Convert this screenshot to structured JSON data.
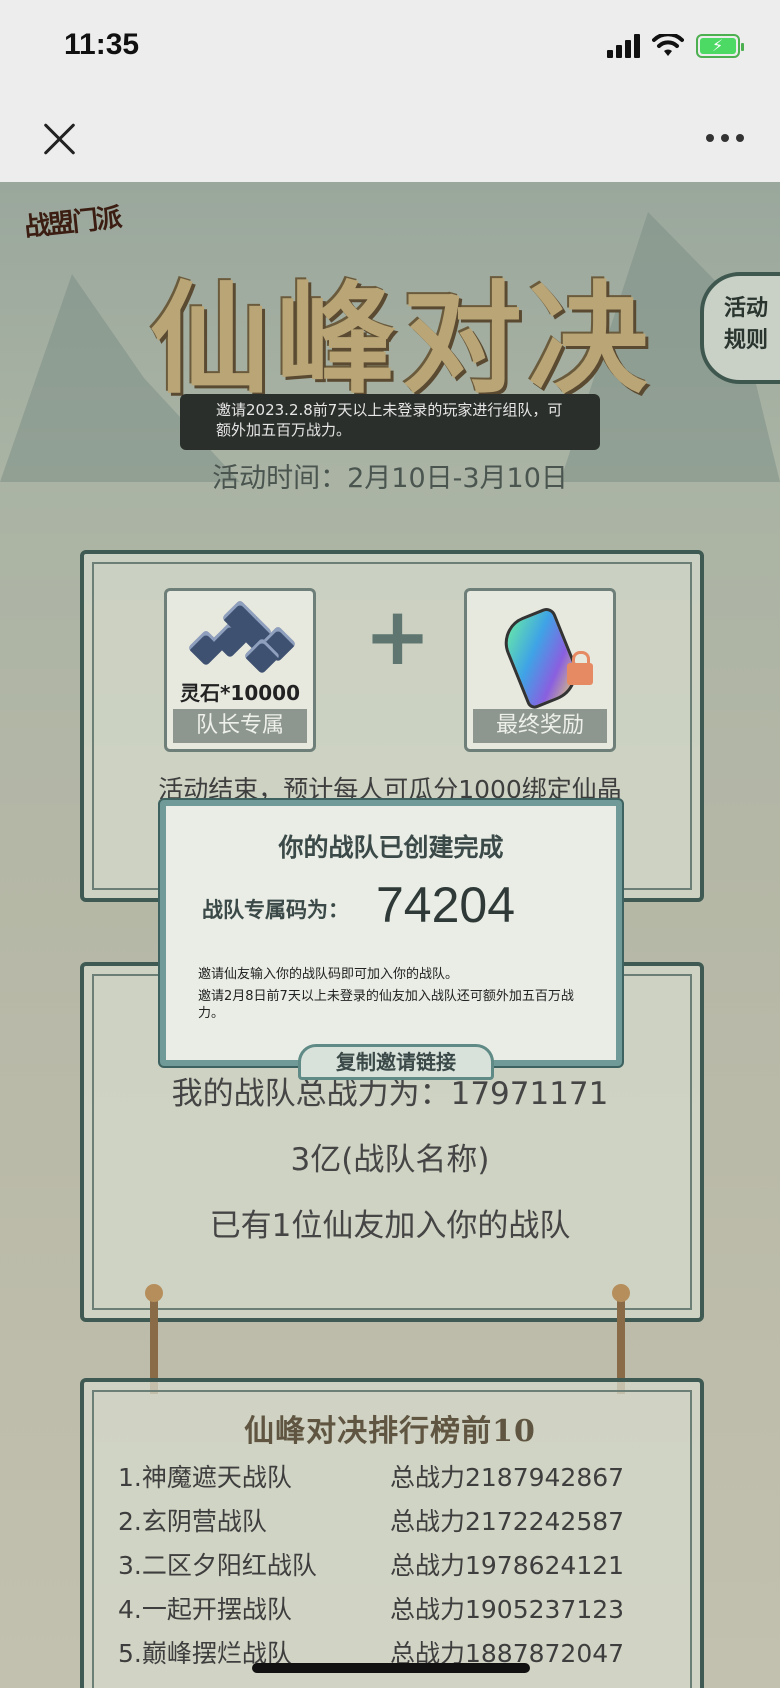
{
  "status_bar": {
    "time": "11:35"
  },
  "nav": {
    "close_icon": "close-icon",
    "more_icon": "more-icon"
  },
  "header": {
    "logo": "战盟门派",
    "title": "仙峰对决",
    "rules_button": "活动规则",
    "invite_banner": "邀请2023.2.8前7天以上未登录的玩家进行组队，可额外加五百万战力。",
    "activity_time": "活动时间：2月10日-3月10日"
  },
  "rewards": {
    "left_item_count": "灵石*10000",
    "left_label": "队长专属",
    "right_label": "最终奖励",
    "note": "活动结束，预计每人可瓜分1000绑定仙晶"
  },
  "team": {
    "total_power": "我的战队总战力为：17971171",
    "team_name": "3亿(战队名称)",
    "members": "已有1位仙友加入你的战队"
  },
  "leaderboard": {
    "title": "仙峰对决排行榜前10",
    "rows": [
      {
        "name": "1.神魔遮天战队",
        "power": "总战力2187942867"
      },
      {
        "name": "2.玄阴营战队",
        "power": "总战力2172242587"
      },
      {
        "name": "3.二区夕阳红战队",
        "power": "总战力1978624121"
      },
      {
        "name": "4.一起开摆战队",
        "power": "总战力1905237123"
      },
      {
        "name": "5.巅峰摆烂战队",
        "power": "总战力1887872047"
      }
    ]
  },
  "modal": {
    "title": "你的战队已创建完成",
    "code_label": "战队专属码为：",
    "code_value": "74204",
    "line1": "邀请仙友输入你的战队码即可加入你的战队。",
    "line2": "邀请2月8日前7天以上未登录的仙友加入战队还可额外加五百万战力。",
    "copy_button": "复制邀请链接"
  },
  "colors": {
    "accent": "#3e5a52",
    "modal_border": "#6f9a97",
    "battery": "#4cd964"
  }
}
